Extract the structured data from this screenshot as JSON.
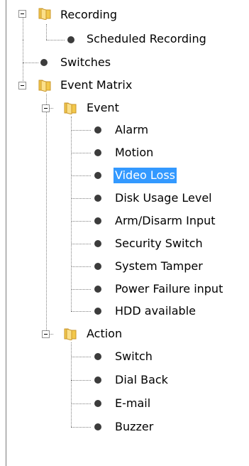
{
  "tree": {
    "recording": {
      "label": "Recording",
      "children": {
        "scheduled_recording": "Scheduled Recording"
      }
    },
    "switches": "Switches",
    "event_matrix": {
      "label": "Event Matrix",
      "event": {
        "label": "Event",
        "items": {
          "alarm": "Alarm",
          "motion": "Motion",
          "video_loss": "Video Loss",
          "disk_usage_level": "Disk Usage Level",
          "arm_disarm_input": "Arm/Disarm Input",
          "security_switch": "Security Switch",
          "system_tamper": "System Tamper",
          "power_failure_input": "Power Failure input",
          "hdd_available": "HDD available"
        }
      },
      "action": {
        "label": "Action",
        "items": {
          "switch": "Switch",
          "dial_back": "Dial Back",
          "email": "E-mail",
          "buzzer": "Buzzer"
        }
      }
    },
    "selected": "Video Loss",
    "colors": {
      "selection": "#3399ff",
      "folder": "#f2c84b",
      "bullet": "#3c3c3c",
      "connector": "#808080"
    }
  }
}
